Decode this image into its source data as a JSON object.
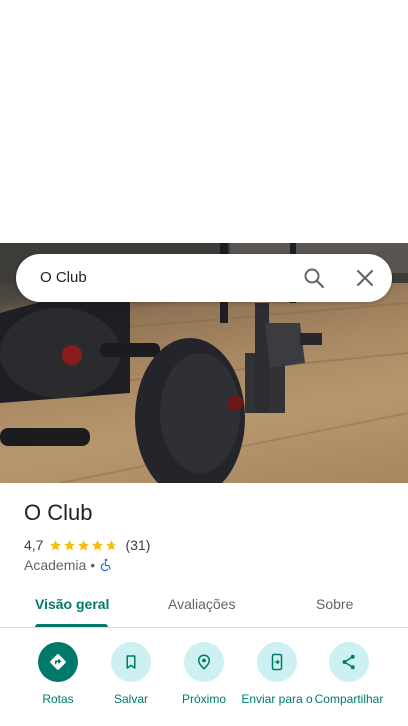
{
  "search": {
    "query": "O Club"
  },
  "place": {
    "name": "O Club",
    "rating": "4,7",
    "review_count": "(31)",
    "stars_value": 4.7,
    "category": "Academia",
    "separator": "•"
  },
  "tabs": [
    {
      "label": "Visão geral",
      "active": true
    },
    {
      "label": "Avaliações",
      "active": false
    },
    {
      "label": "Sobre",
      "active": false
    }
  ],
  "actions": [
    {
      "label": "Rotas",
      "icon": "directions-icon"
    },
    {
      "label": "Salvar",
      "icon": "bookmark-icon"
    },
    {
      "label": "Próximo",
      "icon": "nearby-icon"
    },
    {
      "label": "Enviar para o",
      "icon": "send-to-phone-icon"
    },
    {
      "label": "Compartilhar",
      "icon": "share-icon"
    }
  ],
  "colors": {
    "accent": "#00796b",
    "action_bg": "#cdf0f3",
    "star": "#fbbc04"
  }
}
